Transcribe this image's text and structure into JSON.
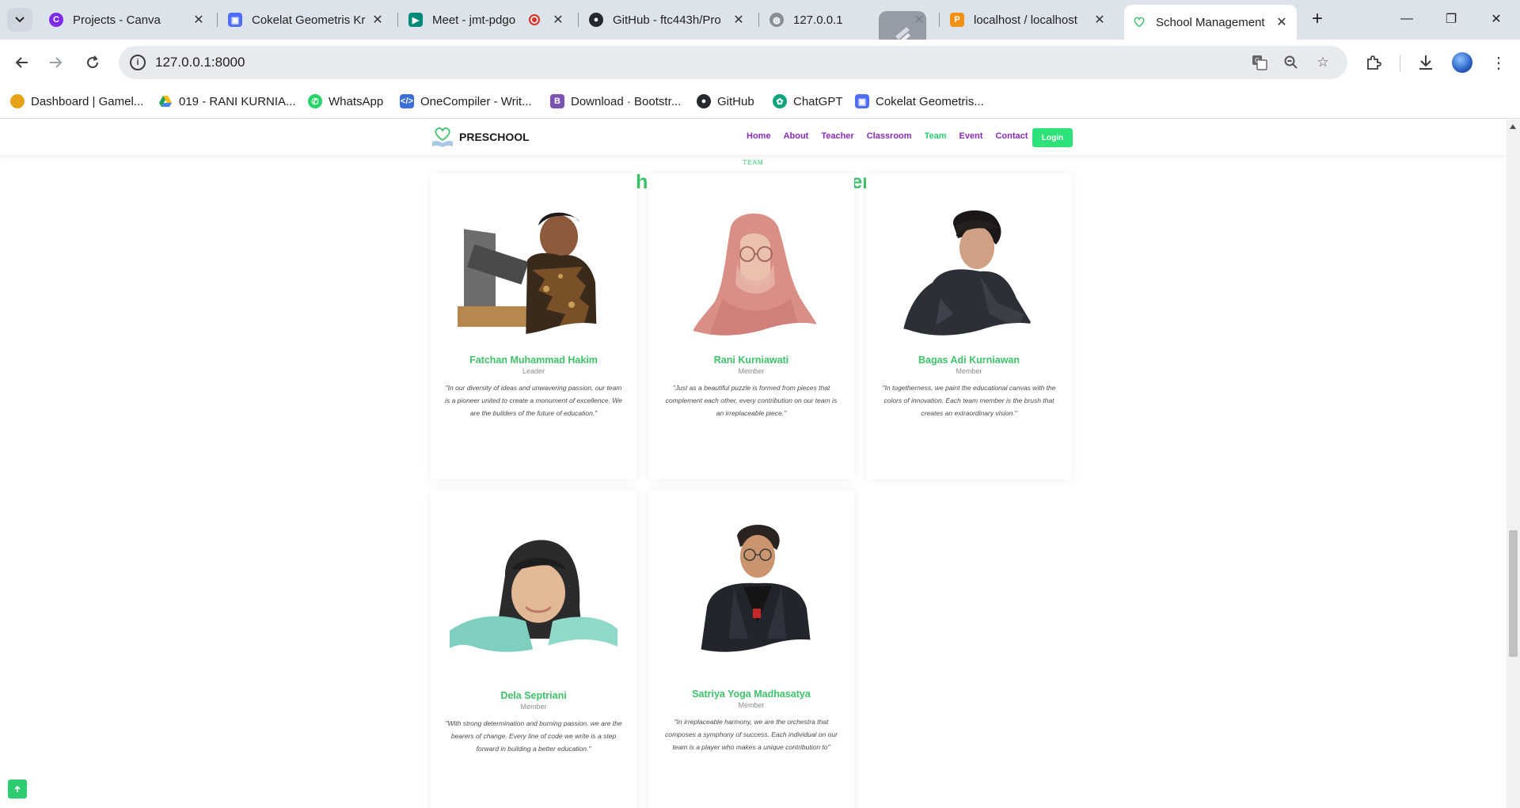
{
  "browser": {
    "tabs": [
      {
        "title": "Projects - Canva",
        "icon": "canva-icon",
        "color": "#7d2ae8"
      },
      {
        "title": "Cokelat Geometris Kr",
        "icon": "slides-icon",
        "color": "#4f6ef7"
      },
      {
        "title": "Meet - jmt-pdgo",
        "icon": "meet-icon",
        "color": "#00897b",
        "recording": true
      },
      {
        "title": "GitHub - ftc443h/Pro",
        "icon": "github-icon",
        "color": "#24292f"
      },
      {
        "title": "127.0.0.1",
        "icon": "globe-icon",
        "color": "#8a8f95"
      },
      {
        "title": "localhost / localhost",
        "icon": "phpmyadmin-icon",
        "color": "#f29111"
      },
      {
        "title": "School Management",
        "icon": "heart-book-icon",
        "color": "#3ec26a",
        "active": true
      }
    ],
    "url": "127.0.0.1:8000",
    "bookmarks": [
      {
        "label": "Dashboard | Gamel...",
        "icon": "dashboard-icon",
        "color": "#e6a21a"
      },
      {
        "label": "019 - RANI KURNIA...",
        "icon": "drive-icon",
        "color": "#1e9e56"
      },
      {
        "label": "WhatsApp",
        "icon": "whatsapp-icon",
        "color": "#25d366"
      },
      {
        "label": "OneCompiler - Writ...",
        "icon": "code-icon",
        "color": "#3b6fd8"
      },
      {
        "label": "Download · Bootstr...",
        "icon": "bootstrap-icon",
        "color": "#7952b3"
      },
      {
        "label": "GitHub",
        "icon": "github-icon",
        "color": "#24292f"
      },
      {
        "label": "ChatGPT",
        "icon": "chatgpt-icon",
        "color": "#10a37f"
      },
      {
        "label": "Cokelat Geometris...",
        "icon": "slides-icon",
        "color": "#4f6ef7"
      }
    ]
  },
  "site": {
    "brand": "PRESCHOOL",
    "menu": [
      "Home",
      "About",
      "Teacher",
      "Classroom",
      "Team",
      "Event",
      "Contact"
    ],
    "active_menu": "Team",
    "login_label": "Login",
    "colors": {
      "accent": "#2ecc71",
      "menu": "#8b2bb9",
      "title": "#3ec26a"
    }
  },
  "team": {
    "tag": "TEAM",
    "title": "Our School Management System Team",
    "members": [
      {
        "name": "Fatchan Muhammad Hakim",
        "role": "Leader",
        "quote": "\"In our diversity of ideas and unwavering passion, our team is a pioneer united to create a monument of excellence. We are the builders of the future of education.\""
      },
      {
        "name": "Rani Kurniawati",
        "role": "Member",
        "quote": "\"Just as a beautiful puzzle is formed from pieces that complement each other, every contribution on our team is an irreplaceable piece.\""
      },
      {
        "name": "Bagas Adi Kurniawan",
        "role": "Member",
        "quote": "\"In togetherness, we paint the educational canvas with the colors of innovation. Each team member is the brush that creates an extraordinary vision.\""
      },
      {
        "name": "Dela Septriani",
        "role": "Member",
        "quote": "\"With strong determination and burning passion, we are the bearers of change. Every line of code we write is a step forward in building a better education.\""
      },
      {
        "name": "Satriya Yoga Madhasatya",
        "role": "Member",
        "quote": "\"In irreplaceable harmony, we are the orchestra that composes a symphony of success. Each individual on our team is a player who makes a unique contribution to\""
      }
    ]
  },
  "back_to_top_icon": "arrow-up-icon"
}
